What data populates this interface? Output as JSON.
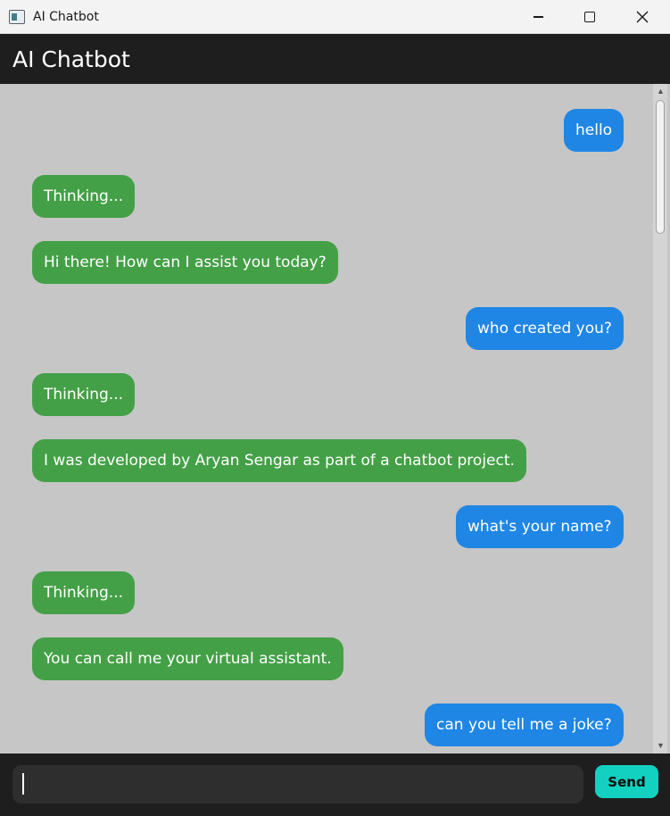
{
  "window": {
    "title": "AI Chatbot",
    "minimize_icon": "minimize-icon",
    "maximize_icon": "maximize-icon",
    "close_icon": "close-icon",
    "close_glyph": "✕"
  },
  "header": {
    "title": "AI Chatbot"
  },
  "messages": [
    {
      "sender": "user",
      "text": "hello"
    },
    {
      "sender": "bot",
      "text": "Thinking..."
    },
    {
      "sender": "bot",
      "text": "Hi there! How can I assist you today?"
    },
    {
      "sender": "user",
      "text": "who created you?"
    },
    {
      "sender": "bot",
      "text": "Thinking..."
    },
    {
      "sender": "bot",
      "text": "I was developed by Aryan Sengar as part of a chatbot project."
    },
    {
      "sender": "user",
      "text": "what's your name?"
    },
    {
      "sender": "bot",
      "text": "Thinking..."
    },
    {
      "sender": "bot",
      "text": "You can call me your virtual assistant."
    },
    {
      "sender": "user",
      "text": "can you tell me a joke?"
    }
  ],
  "input": {
    "value": "",
    "placeholder": ""
  },
  "send_button": {
    "label": "Send"
  },
  "colors": {
    "user_bubble": "#1f86e5",
    "bot_bubble": "#44a047",
    "chat_background": "#c6c6c6",
    "header_background": "#1e1e1e",
    "send_button": "#12d1c0"
  }
}
